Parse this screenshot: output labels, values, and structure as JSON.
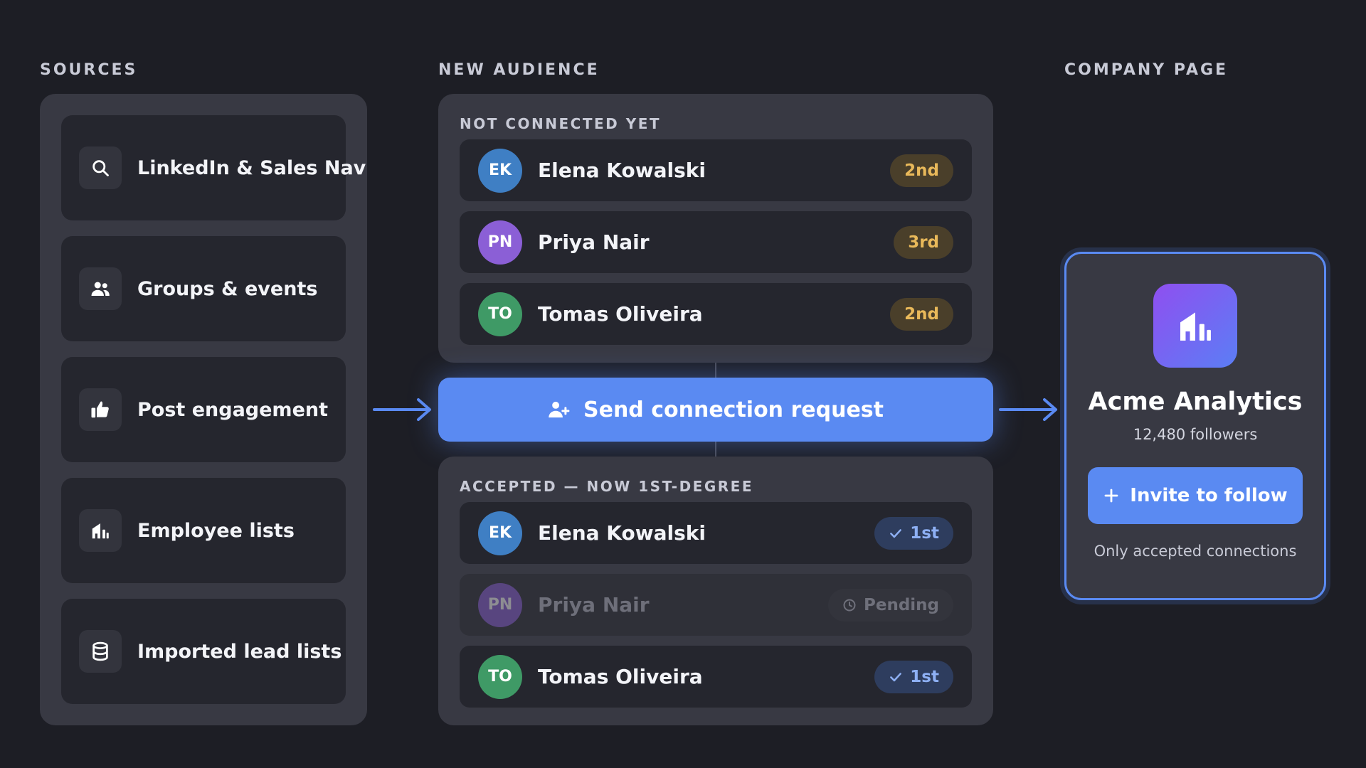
{
  "columns": {
    "sources": "SOURCES",
    "audience": "NEW AUDIENCE",
    "company": "COMPANY PAGE"
  },
  "sources": [
    {
      "label": "LinkedIn & Sales Nav",
      "icon": "search-icon"
    },
    {
      "label": "Groups & events",
      "icon": "people-icon"
    },
    {
      "label": "Post engagement",
      "icon": "thumbs-up-icon"
    },
    {
      "label": "Employee lists",
      "icon": "building-icon"
    },
    {
      "label": "Imported lead lists",
      "icon": "database-icon"
    }
  ],
  "not_connected": {
    "label": "NOT CONNECTED YET",
    "people": [
      {
        "initials": "EK",
        "name": "Elena Kowalski",
        "degree": "2nd",
        "color": "#3f7fc4"
      },
      {
        "initials": "PN",
        "name": "Priya Nair",
        "degree": "3rd",
        "color": "#8b5fd6"
      },
      {
        "initials": "TO",
        "name": "Tomas Oliveira",
        "degree": "2nd",
        "color": "#3f9a66"
      }
    ]
  },
  "action": {
    "label": "Send connection request",
    "icon": "user-plus-icon"
  },
  "accepted": {
    "label": "ACCEPTED — NOW 1ST-DEGREE",
    "people": [
      {
        "initials": "EK",
        "name": "Elena Kowalski",
        "status": "1st",
        "state": "accepted",
        "color": "#3f7fc4"
      },
      {
        "initials": "PN",
        "name": "Priya Nair",
        "status": "Pending",
        "state": "pending",
        "color": "#8b5fd6"
      },
      {
        "initials": "TO",
        "name": "Tomas Oliveira",
        "status": "1st",
        "state": "accepted",
        "color": "#3f9a66"
      }
    ]
  },
  "company": {
    "name": "Acme Analytics",
    "followers": "12,480 followers",
    "invite_label": "Invite to follow",
    "note": "Only accepted connections",
    "icon": "building-icon"
  },
  "colors": {
    "accent": "#5a8af2",
    "background": "#1d1e25",
    "panel": "#383943",
    "card": "#25262e",
    "degree_text": "#e9b95a",
    "first_text": "#8eb0f4"
  }
}
